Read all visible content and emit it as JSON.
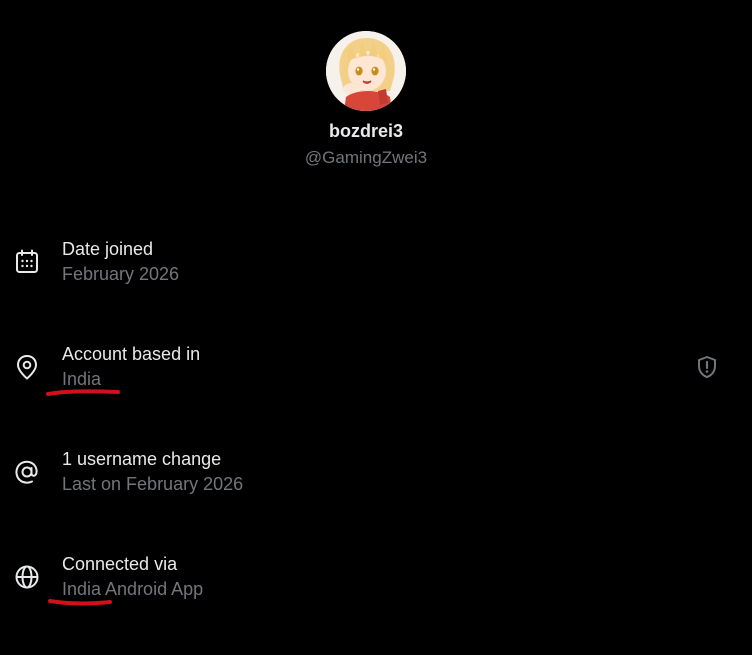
{
  "profile": {
    "display_name": "bozdrei3",
    "handle": "@GamingZwei3"
  },
  "rows": [
    {
      "label": "Date joined",
      "value": "February 2026",
      "icon": "calendar-icon"
    },
    {
      "label": "Account based in",
      "value": "India",
      "icon": "location-pin-icon"
    },
    {
      "label": "1 username change",
      "value": "Last on February 2026",
      "icon": "at-sign-icon"
    },
    {
      "label": "Connected via",
      "value": "India Android App",
      "icon": "globe-icon"
    }
  ],
  "colors": {
    "background": "#000000",
    "primary_text": "#e7e9ea",
    "secondary_text": "#71767b",
    "annotation": "#d0101a"
  }
}
